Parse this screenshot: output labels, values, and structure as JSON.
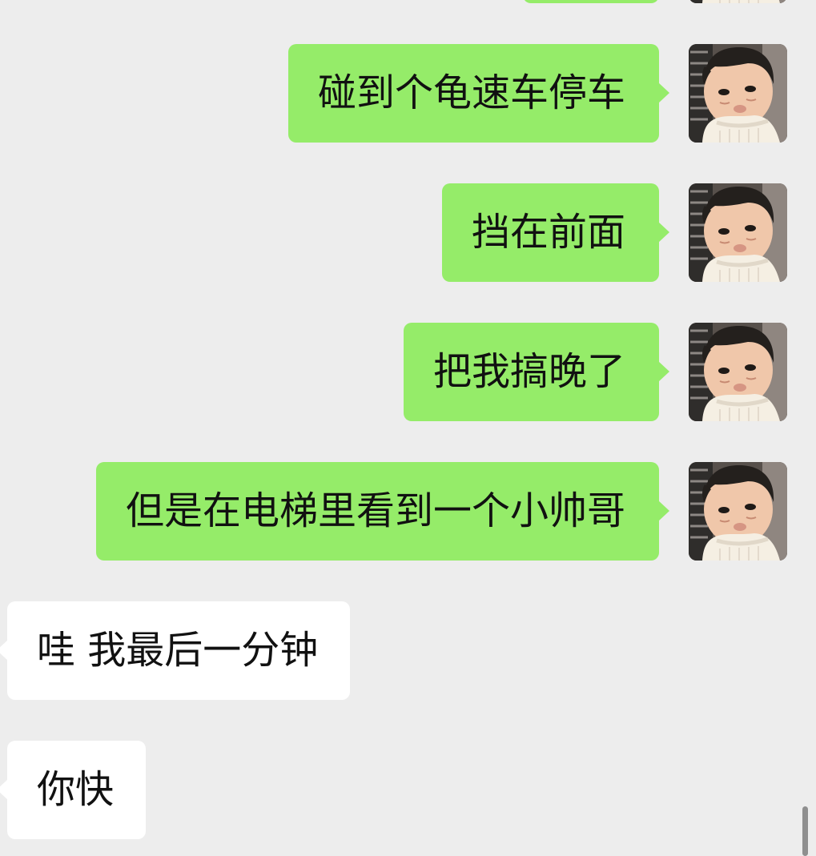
{
  "chat": {
    "background": "#ededed",
    "outgoing_bubble_color": "#95ec69",
    "incoming_bubble_color": "#ffffff",
    "avatar_icon": "child-photo-avatar",
    "messages": [
      {
        "direction": "outgoing",
        "text": ""
      },
      {
        "direction": "outgoing",
        "text": "碰到个龟速车停车"
      },
      {
        "direction": "outgoing",
        "text": "挡在前面"
      },
      {
        "direction": "outgoing",
        "text": "把我搞晚了"
      },
      {
        "direction": "outgoing",
        "text": "但是在电梯里看到一个小帅哥"
      },
      {
        "direction": "incoming",
        "text": "哇 我最后一分钟"
      },
      {
        "direction": "incoming",
        "text": "你快"
      }
    ]
  }
}
